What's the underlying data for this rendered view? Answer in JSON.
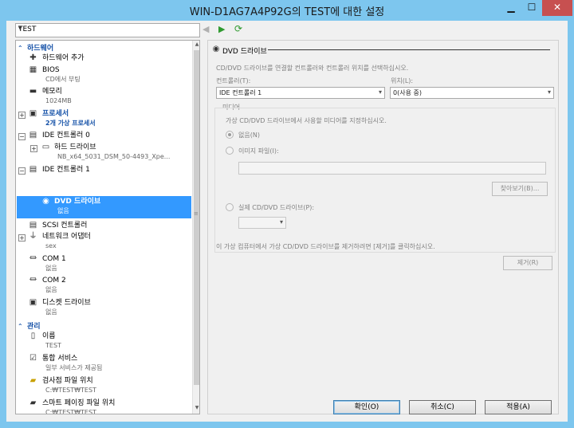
{
  "window": {
    "title": "WIN-D1AG7A4P92G의 TEST에 대한 설정"
  },
  "vm_select": {
    "value": "TEST"
  },
  "tree": {
    "hardware_header": "하드웨어",
    "add_hardware": "하드웨어 추가",
    "bios": {
      "label": "BIOS",
      "sub": "CD에서 부팅"
    },
    "memory": {
      "label": "메모리",
      "sub": "1024MB"
    },
    "processor": {
      "label": "프로세서",
      "sub": "2개 가상 프로세서"
    },
    "ide0": {
      "label": "IDE 컨트롤러 0"
    },
    "hard_drive": {
      "label": "하드 드라이브",
      "sub": "NB_x64_5031_DSM_50-4493_Xpe..."
    },
    "ide1": {
      "label": "IDE 컨트롤러 1"
    },
    "dvd_drive": {
      "label": "DVD 드라이브",
      "sub": "없음"
    },
    "scsi": {
      "label": "SCSI 컨트롤러"
    },
    "network": {
      "label": "네트워크 어댑터",
      "sub": "sex"
    },
    "com1": {
      "label": "COM 1",
      "sub": "없음"
    },
    "com2": {
      "label": "COM 2",
      "sub": "없음"
    },
    "floppy": {
      "label": "디스켓 드라이브",
      "sub": "없음"
    },
    "management_header": "관리",
    "name": {
      "label": "이름",
      "sub": "TEST"
    },
    "integration": {
      "label": "통합 서비스",
      "sub": "일부 서비스가 제공됨"
    },
    "snapshot": {
      "label": "검사점 파일 위치",
      "sub": "C:₩TEST₩TEST"
    },
    "smart_paging": {
      "label": "스마트 페이징 파일 위치",
      "sub": "C:₩TEST₩TEST"
    }
  },
  "panel": {
    "title": "DVD 드라이브",
    "description": "CD/DVD 드라이브를 연결할 컨트롤러와 컨트롤러 위치를 선택하십시오.",
    "controller_label": "컨트롤러(T):",
    "controller_value": "IDE 컨트롤러 1",
    "location_label": "위치(L):",
    "location_value": "0(사용 중)",
    "media_group": "미디어",
    "media_desc": "가상 CD/DVD 드라이브에서 사용할 미디어를 지정하십시오.",
    "option_none": "없음(N)",
    "option_image": "이미지 파일(I):",
    "image_path": "",
    "browse": "찾아보기(B)...",
    "option_physical": "실제 CD/DVD 드라이브(P):",
    "physical_value": "",
    "remove_hint": "이 가상 컴퓨터에서 가상 CD/DVD 드라이브를 제거하려면 [제거]를 클릭하십시오.",
    "remove": "제거(R)"
  },
  "footer": {
    "ok": "확인(O)",
    "cancel": "취소(C)",
    "apply": "적용(A)"
  },
  "colors": {
    "title_bg": "#7dc6ee",
    "selection": "#3399ff",
    "section_header": "#1652a8",
    "close_button": "#c75050"
  }
}
